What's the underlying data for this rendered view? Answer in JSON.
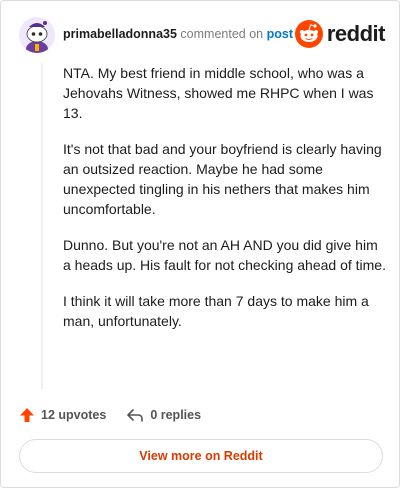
{
  "header": {
    "username": "primabelladonna35",
    "commented_on": "commented on",
    "post_label": "post",
    "logo_text": "reddit"
  },
  "comment": {
    "paragraphs": [
      "NTA. My best friend in middle school, who was a Jehovahs Witness, showed me RHPC when I was 13.",
      "It's not that bad and your boyfriend is clearly having an outsized reaction. Maybe he had some unexpected tingling in his nethers that makes him uncomfortable.",
      "Dunno. But you're not an AH AND you did give him a heads up. His fault for not checking ahead of time.",
      "I think it will take more than 7 days to make him a man, unfortunately."
    ]
  },
  "actions": {
    "upvotes": "12 upvotes",
    "replies": "0 replies"
  },
  "footer": {
    "view_more": "View more on Reddit"
  },
  "colors": {
    "brand": "#ff4500",
    "link": "#0079d3",
    "cta": "#d93a00"
  }
}
